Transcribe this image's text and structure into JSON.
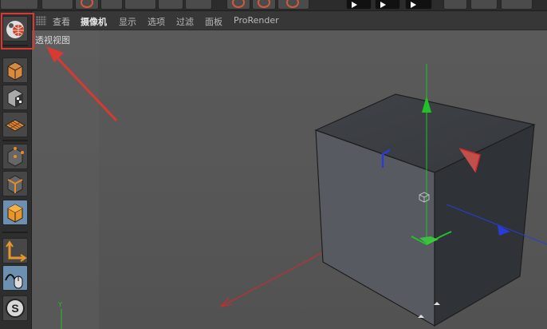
{
  "toolbar": {
    "buttons": [
      "camera-icon",
      "light-icon",
      "cube-primitive-icon",
      "deformer-icon",
      "spline-icon",
      "render-region-icon",
      "render-view-icon",
      "render-settings-icon",
      "play-icon",
      "play-forward-icon",
      "record-icon",
      "sphere-icon",
      "settings-icon"
    ]
  },
  "left_toolbar": {
    "buttons": [
      {
        "name": "perspective-view-button",
        "icon": "perspective-view-icon",
        "active": false
      },
      {
        "name": "cube-model-button",
        "icon": "cube-icon",
        "active": false
      },
      {
        "name": "texture-mode-button",
        "icon": "checker-cube-icon",
        "active": false
      },
      {
        "name": "workplane-button",
        "icon": "grid-plane-icon",
        "active": false
      },
      {
        "name": "points-mode-button",
        "icon": "points-cube-icon",
        "active": false
      },
      {
        "name": "edges-mode-button",
        "icon": "edges-cube-icon",
        "active": false
      },
      {
        "name": "polygons-mode-button",
        "icon": "polygons-cube-icon",
        "active": true
      },
      {
        "name": "axis-mode-button",
        "icon": "axis-icon",
        "active": false
      },
      {
        "name": "tweak-mode-button",
        "icon": "mouse-tweak-icon",
        "active": false
      },
      {
        "name": "snap-button",
        "icon": "snap-s-icon",
        "active": false
      }
    ]
  },
  "viewport_menu": {
    "items": [
      {
        "label": "查看",
        "selected": false
      },
      {
        "label": "摄像机",
        "selected": true
      },
      {
        "label": "显示",
        "selected": false
      },
      {
        "label": "选项",
        "selected": false
      },
      {
        "label": "过滤",
        "selected": false
      },
      {
        "label": "面板",
        "selected": false
      },
      {
        "label": "ProRender",
        "selected": false
      }
    ]
  },
  "viewport": {
    "label": "透视视图",
    "world_axis_label": "Y"
  },
  "colors": {
    "highlight_red": "#d83a32",
    "x_axis": "#d8262a",
    "y_axis": "#22c02a",
    "z_axis": "#2a3cd8",
    "active_button": "#6d8fb0",
    "viewport_bg": "#575757"
  }
}
